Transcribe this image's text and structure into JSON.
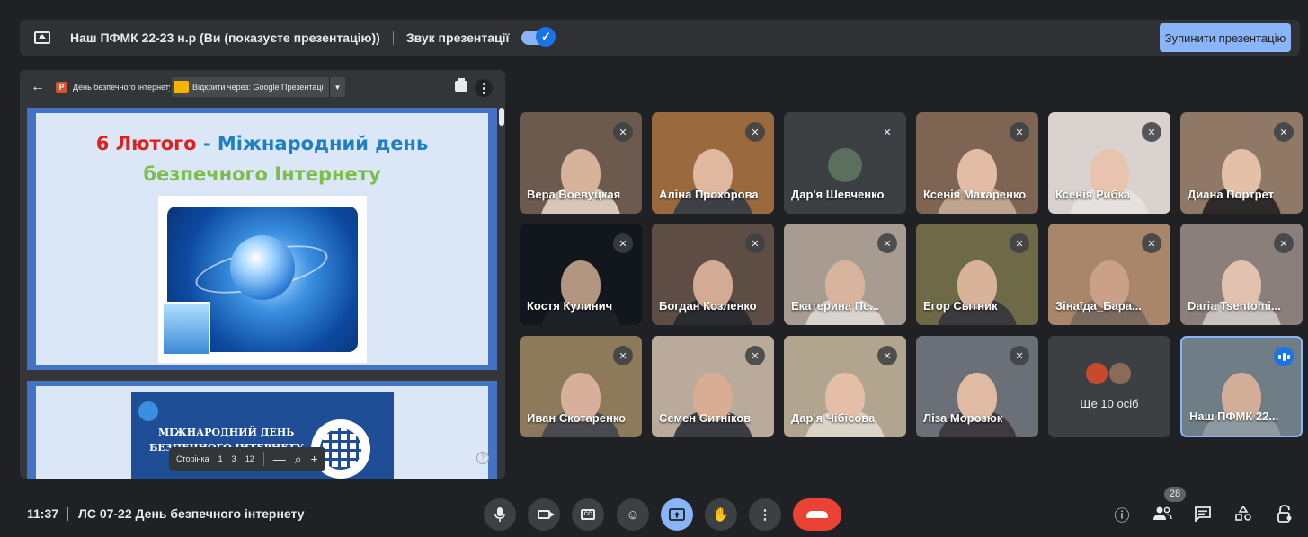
{
  "presenting_bar": {
    "title": "Наш ПФМК 22-23 н.р (Ви (показуєте презентацію))",
    "sound_label": "Звук презентації",
    "sound_enabled": true,
    "stop_button": "Зупинити презентацію"
  },
  "presentation": {
    "doc_title": "День безпечного інтернету",
    "open_with": "Відкрити через: Google Презентації",
    "slide1": {
      "line1_red": "6 Лютого",
      "line1_dash": " - ",
      "line1_blue": "Міжнародний день",
      "line2": "безпечного Інтернету"
    },
    "slide2": {
      "line1": "МІЖНАРОДНИЙ ДЕНЬ",
      "line2": "БЕЗПЕЧНОГО ІНТЕРНЕТУ"
    },
    "pager": {
      "label": "Сторінка",
      "current": "1",
      "page": "3",
      "total": "12",
      "zoom_out": "—",
      "zoom_in": "+"
    }
  },
  "participants": [
    {
      "name": "Вера Воевуцкая",
      "muted": true
    },
    {
      "name": "Аліна Прохорова",
      "muted": true
    },
    {
      "name": "Дар'я Шевченко",
      "muted": true
    },
    {
      "name": "Ксенія Макаренко",
      "muted": true
    },
    {
      "name": "Ксенія Рибка",
      "muted": true
    },
    {
      "name": "Диана Портрет",
      "muted": true
    },
    {
      "name": "Костя Кулинич",
      "muted": true
    },
    {
      "name": "Богдан Козленко",
      "muted": true
    },
    {
      "name": "Екатерина Пе...",
      "muted": true
    },
    {
      "name": "Егор Сытник",
      "muted": true
    },
    {
      "name": "Зінаїда_Бара...",
      "muted": true
    },
    {
      "name": "Daria Tsentomi...",
      "muted": true
    },
    {
      "name": "Иван Скотаренко",
      "muted": true
    },
    {
      "name": "Семен Ситніков",
      "muted": true
    },
    {
      "name": "Дар'я Чібісова",
      "muted": true
    },
    {
      "name": "Ліза Морозюк",
      "muted": true
    },
    {
      "name": "Ще 10 осіб",
      "muted": false
    },
    {
      "name": "Наш ПФМК 22...",
      "muted": false
    }
  ],
  "bottom_bar": {
    "time": "11:37",
    "meeting": "ЛС 07-22 День безпечного інтернету",
    "participant_count": "28",
    "cc_label": "CC"
  },
  "icons": {
    "mic": "mic-icon",
    "camera": "camera-icon",
    "captions": "captions-icon",
    "emoji": "emoji-icon",
    "present": "present-screen-icon",
    "hand": "raise-hand-icon",
    "more": "more-options-icon",
    "hangup": "hang-up-icon",
    "info": "info-icon",
    "people": "people-icon",
    "chat": "chat-icon",
    "activities": "activities-icon",
    "lock": "host-controls-icon"
  },
  "colors": {
    "background": "#202124",
    "accent": "#8ab4f8",
    "hangup": "#ea4335"
  }
}
